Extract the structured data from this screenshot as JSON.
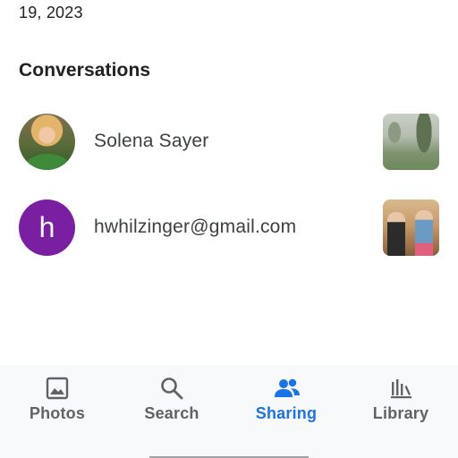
{
  "header": {
    "date_fragment": "19, 2023"
  },
  "conversations": {
    "title": "Conversations",
    "items": [
      {
        "name": "Solena Sayer",
        "avatar_type": "photo"
      },
      {
        "name": "hwhilzinger@gmail.com",
        "avatar_type": "letter",
        "avatar_letter": "h",
        "avatar_color": "#7b1fa2"
      }
    ]
  },
  "bottom_nav": {
    "active_color": "#1a73e8",
    "inactive_color": "#5f6368",
    "items": [
      {
        "label": "Photos",
        "icon": "photo-icon",
        "active": false
      },
      {
        "label": "Search",
        "icon": "search-icon",
        "active": false
      },
      {
        "label": "Sharing",
        "icon": "people-icon",
        "active": true
      },
      {
        "label": "Library",
        "icon": "library-icon",
        "active": false
      }
    ]
  }
}
